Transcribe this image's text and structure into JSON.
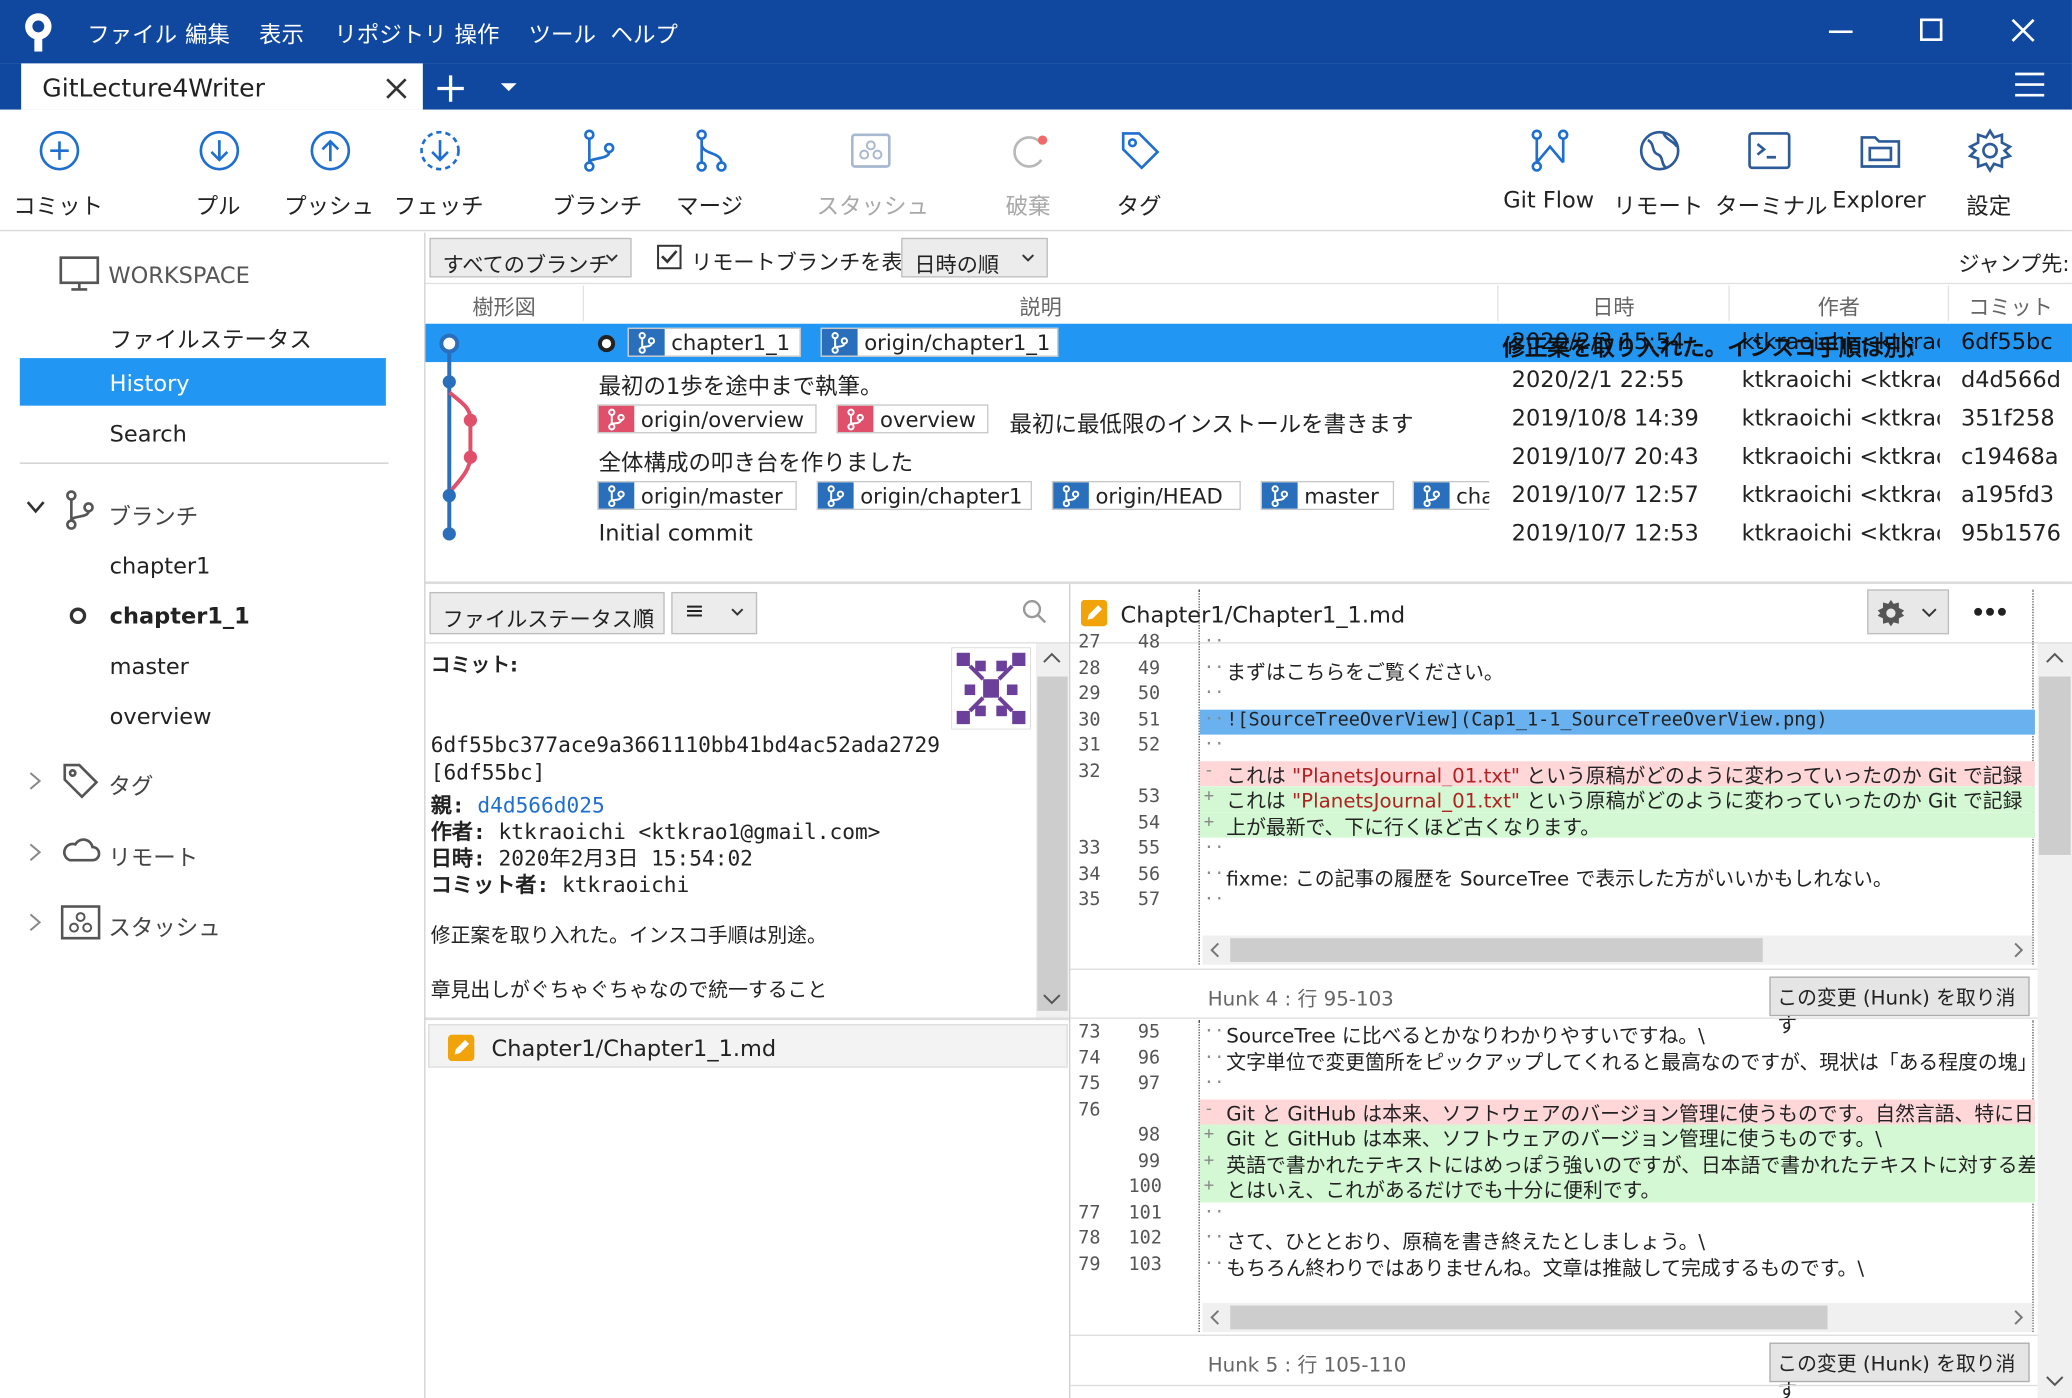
{
  "window": {
    "menu": [
      "ファイル",
      "編集",
      "表示",
      "リポジトリ",
      "操作",
      "ツール",
      "ヘルプ"
    ],
    "minimize": "—",
    "maximize": "☐",
    "close": "✕"
  },
  "tab": {
    "title": "GitLecture4Writer",
    "close": "✕",
    "add": "+",
    "menu": "≡"
  },
  "toolbar": {
    "commit": "コミット",
    "pull": "プル",
    "push": "プッシュ",
    "fetch": "フェッチ",
    "branch": "ブランチ",
    "merge": "マージ",
    "stash": "スタッシュ",
    "discard": "破棄",
    "tag": "タグ",
    "gitflow": "Git Flow",
    "remote": "リモート",
    "terminal": "ターミナル",
    "explorer": "Explorer",
    "settings": "設定"
  },
  "sidebar": {
    "workspace": "WORKSPACE",
    "file_status": "ファイルステータス",
    "history": "History",
    "search": "Search",
    "branches_header": "ブランチ",
    "branches": [
      "chapter1",
      "chapter1_1",
      "master",
      "overview"
    ],
    "current_branch": "chapter1_1",
    "tags": "タグ",
    "remote": "リモート",
    "stash": "スタッシュ"
  },
  "filter": {
    "branches": "すべてのブランチ",
    "show_remote": "リモートブランチを表示",
    "order": "日時の順",
    "jump": "ジャンプ先:"
  },
  "history": {
    "headers": {
      "graph": "樹形図",
      "desc": "説明",
      "date": "日時",
      "author": "作者",
      "commit": "コミット"
    },
    "rows": [
      {
        "labels": [
          "chapter1_1",
          "origin/chapter1_1"
        ],
        "message": "修正案を取り入れた。インスコ手順は別途。",
        "date": "2020/2/3  15:54",
        "author": "ktkraoichi <ktkrac",
        "commit": "6df55bc"
      },
      {
        "labels": [],
        "message": "最初の1歩を途中まで執筆。",
        "date": "2020/2/1  22:55",
        "author": "ktkraoichi <ktkrao",
        "commit": "d4d566d"
      },
      {
        "labels": [
          "origin/overview",
          "overview"
        ],
        "message": "最初に最低限のインストールを書きます",
        "date": "2019/10/8  14:39",
        "author": "ktkraoichi <ktkrao",
        "commit": "351f258"
      },
      {
        "labels": [],
        "message": "全体構成の叩き台を作りました",
        "date": "2019/10/7  20:43",
        "author": "ktkraoichi <ktkrao",
        "commit": "c19468a"
      },
      {
        "labels": [
          "origin/master",
          "origin/chapter1",
          "origin/HEAD",
          "master",
          "cha"
        ],
        "message": "",
        "date": "2019/10/7  12:57",
        "author": "ktkraoichi <ktkrao",
        "commit": "a195fd3"
      },
      {
        "labels": [],
        "message": "Initial commit",
        "date": "2019/10/7  12:53",
        "author": "ktkraoichi <ktkrao",
        "commit": "95b1576"
      }
    ]
  },
  "files": {
    "sort": "ファイルステータス順",
    "view": "≡",
    "list": [
      "Chapter1/Chapter1_1.md"
    ]
  },
  "commit_detail": {
    "commit_label": "コミット:",
    "hash": "6df55bc377ace9a3661110bb41bd4ac52ada2729",
    "short": "[6df55bc]",
    "parent_label": "親:",
    "parent": "d4d566d025",
    "author_label": "作者:",
    "author": "ktkraoichi <ktkrao1@gmail.com>",
    "date_label": "日時:",
    "date": "2020年2月3日 15:54:02",
    "committer_label": "コミット者:",
    "committer": "ktkraoichi",
    "message1": "修正案を取り入れた。インスコ手順は別途。",
    "message2": "章見出しがぐちゃぐちゃなので統一すること"
  },
  "diff": {
    "file": "Chapter1/Chapter1_1.md",
    "hunk1": [
      {
        "o": "27",
        "n": "48",
        "t": "ctx",
        "s": ""
      },
      {
        "o": "28",
        "n": "49",
        "t": "ctx",
        "s": "まずはこちらをご覧ください。"
      },
      {
        "o": "29",
        "n": "50",
        "t": "ctx",
        "s": ""
      },
      {
        "o": "30",
        "n": "51",
        "t": "hl",
        "s": "![SourceTreeOverView](Cap1_1-1_SourceTreeOverView.png)"
      },
      {
        "o": "31",
        "n": "52",
        "t": "ctx",
        "s": ""
      },
      {
        "o": "32",
        "n": "",
        "t": "del",
        "s": "これは \"PlanetsJournal_01.txt\" という原稿がどのように変わっていったのか Git で記録"
      },
      {
        "o": "",
        "n": "53",
        "t": "add",
        "s": "これは \"PlanetsJournal_01.txt\" という原稿がどのように変わっていったのか Git で記録"
      },
      {
        "o": "",
        "n": "54",
        "t": "add",
        "s": "上が最新で、下に行くほど古くなります。"
      },
      {
        "o": "33",
        "n": "55",
        "t": "ctx",
        "s": ""
      },
      {
        "o": "34",
        "n": "56",
        "t": "ctx",
        "s": "fixme: この記事の履歴を SourceTree で表示した方がいいかもしれない。"
      },
      {
        "o": "35",
        "n": "57",
        "t": "ctx",
        "s": ""
      }
    ],
    "hunk4_title": "Hunk 4 : 行 95-103",
    "hunk4": [
      {
        "o": "73",
        "n": "95",
        "t": "ctx",
        "s": "SourceTree に比べるとかなりわかりやすいですね。\\"
      },
      {
        "o": "74",
        "n": "96",
        "t": "ctx",
        "s": "文字単位で変更箇所をピックアップしてくれると最高なのですが、現状は「ある程度の塊」をピックアップ"
      },
      {
        "o": "75",
        "n": "97",
        "t": "ctx",
        "s": ""
      },
      {
        "o": "76",
        "n": "",
        "t": "del",
        "s": "Git と GitHub は本来、ソフトウェアのバージョン管理に使うものです。自然言語、特に日本語"
      },
      {
        "o": "",
        "n": "98",
        "t": "add",
        "s": "Git と GitHub は本来、ソフトウェアのバージョン管理に使うものです。\\"
      },
      {
        "o": "",
        "n": "99",
        "t": "add",
        "s": "英語で書かれたテキストにはめっぽう強いのですが、日本語で書かれたテキストに対する差分比較"
      },
      {
        "o": "",
        "n": "100",
        "t": "add",
        "s": "とはいえ、これがあるだけでも十分に便利です。"
      },
      {
        "o": "77",
        "n": "101",
        "t": "ctx",
        "s": ""
      },
      {
        "o": "78",
        "n": "102",
        "t": "ctx",
        "s": "さて、ひととおり、原稿を書き終えたとしましょう。\\"
      },
      {
        "o": "79",
        "n": "103",
        "t": "ctx",
        "s": "もちろん終わりではありませんね。文章は推敲して完成するものです。\\"
      }
    ],
    "hunk5_title": "Hunk 5 : 行 105-110",
    "discard_hunk": "この変更 (Hunk) を取り消す"
  }
}
